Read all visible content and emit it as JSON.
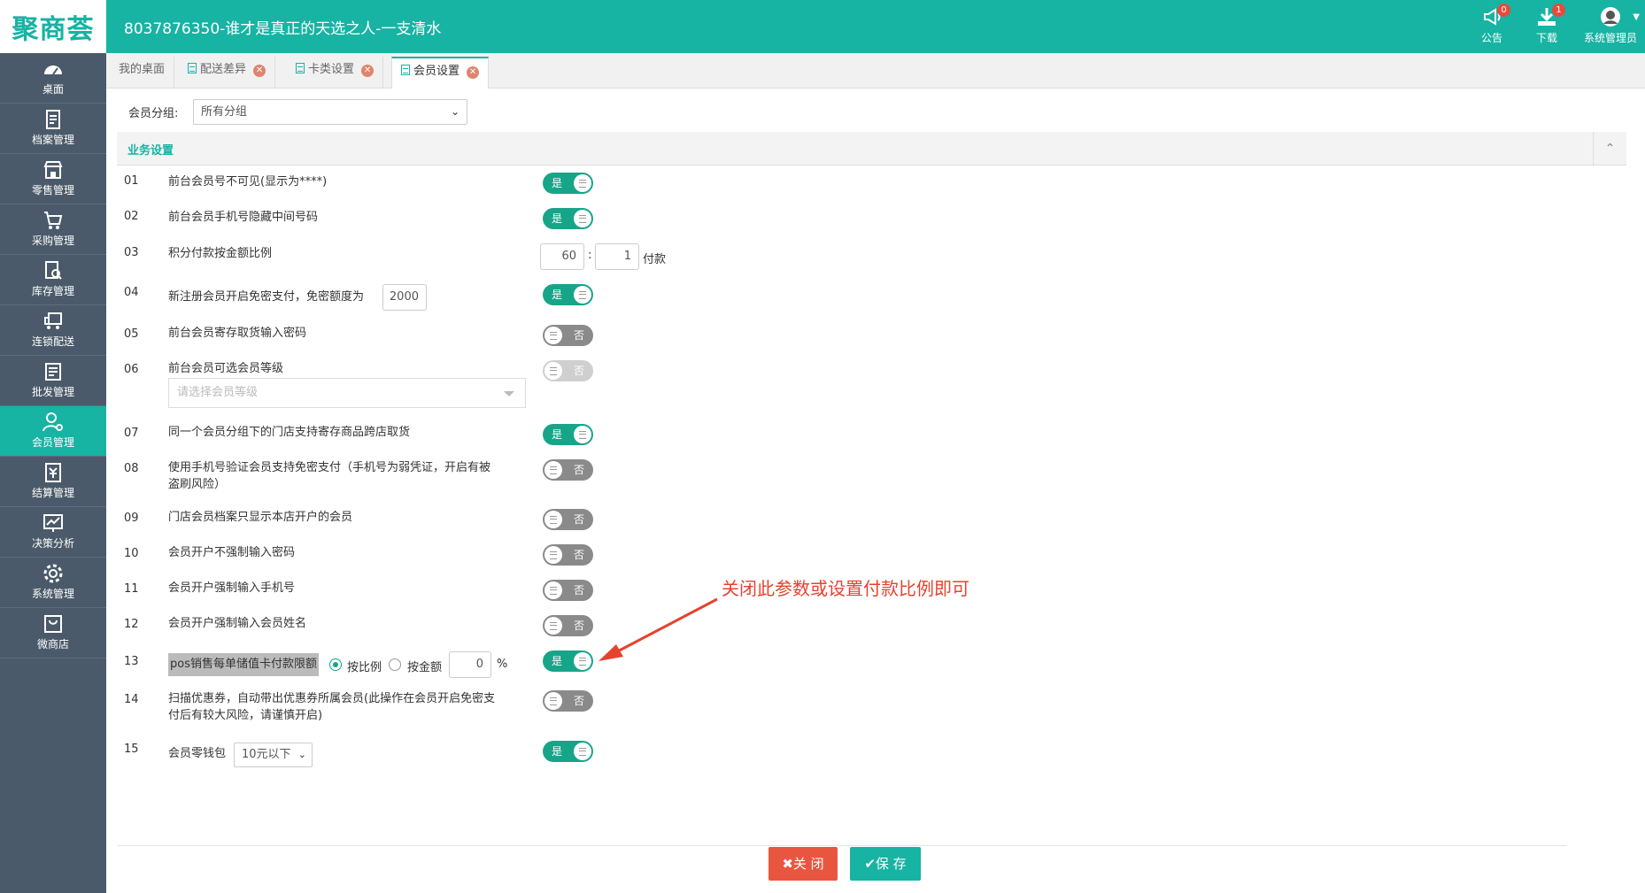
{
  "header": {
    "logo": "聚商荟",
    "title": "8037876350-谁才是真正的天选之人-一支清水",
    "announce": {
      "label": "公告",
      "count": "0"
    },
    "download": {
      "label": "下载",
      "count": "1"
    },
    "user": {
      "label": "系统管理员"
    }
  },
  "sidebar": {
    "items": [
      {
        "label": "桌面",
        "icon": "dashboard-icon"
      },
      {
        "label": "档案管理",
        "icon": "archive-icon"
      },
      {
        "label": "零售管理",
        "icon": "store-icon"
      },
      {
        "label": "采购管理",
        "icon": "cart-icon"
      },
      {
        "label": "库存管理",
        "icon": "inventory-icon"
      },
      {
        "label": "连锁配送",
        "icon": "truck-icon"
      },
      {
        "label": "批发管理",
        "icon": "wholesale-icon"
      },
      {
        "label": "会员管理",
        "icon": "member-icon"
      },
      {
        "label": "结算管理",
        "icon": "settlement-icon"
      },
      {
        "label": "决策分析",
        "icon": "chart-icon"
      },
      {
        "label": "系统管理",
        "icon": "gear-icon"
      },
      {
        "label": "微商店",
        "icon": "bag-icon"
      }
    ],
    "active_index": 7
  },
  "tabs": [
    {
      "label": "我的桌面"
    },
    {
      "label": "配送差异"
    },
    {
      "label": "卡类设置"
    },
    {
      "label": "会员设置"
    }
  ],
  "filter": {
    "label": "会员分组:",
    "value": "所有分组"
  },
  "section": {
    "title": "业务设置"
  },
  "rows": [
    {
      "num": "01",
      "label": "前台会员号不可见(显示为****)",
      "toggle": "是"
    },
    {
      "num": "02",
      "label": "前台会员手机号隐藏中间号码",
      "toggle": "是"
    },
    {
      "num": "03",
      "label": "积分付款按金额比例",
      "ratio_a": "60",
      "sep": ":",
      "ratio_b": "1",
      "unit": "付款"
    },
    {
      "num": "04",
      "label": "新注册会员开启免密支付，免密额度为",
      "amount": "2000",
      "toggle": "是"
    },
    {
      "num": "05",
      "label": "前台会员寄存取货输入密码",
      "toggle": "否"
    },
    {
      "num": "06",
      "label": "前台会员可选会员等级",
      "toggle": "否",
      "placeholder": "请选择会员等级"
    },
    {
      "num": "07",
      "label": "同一个会员分组下的门店支持寄存商品跨店取货",
      "toggle": "是"
    },
    {
      "num": "08",
      "label_line1": "使用手机号验证会员支持免密支付（手机号为弱凭证，开启有被",
      "label_line2": "盗刷风险）",
      "toggle": "否"
    },
    {
      "num": "09",
      "label": "门店会员档案只显示本店开户的会员",
      "toggle": "否"
    },
    {
      "num": "10",
      "label": "会员开户不强制输入密码",
      "toggle": "否"
    },
    {
      "num": "11",
      "label": "会员开户强制输入手机号",
      "toggle": "否"
    },
    {
      "num": "12",
      "label": "会员开户强制输入会员姓名",
      "toggle": "否"
    },
    {
      "num": "13",
      "label": "pos销售每单储值卡付款限额",
      "radio_a": "按比例",
      "radio_b": "按金额",
      "value": "0",
      "unit": "%",
      "toggle": "是"
    },
    {
      "num": "14",
      "label_line1": "扫描优惠券，自动带出优惠券所属会员(此操作在会员开启免密支",
      "label_line2": "付后有较大风险，请谨慎开启)",
      "toggle": "否"
    },
    {
      "num": "15",
      "label": "会员零钱包",
      "select": "10元以下",
      "toggle": "是"
    }
  ],
  "annotation": "关闭此参数或设置付款比例即可",
  "buttons": {
    "close": "关 闭",
    "save": "保 存"
  },
  "colors": {
    "primary": "#17b3a3",
    "sidebar": "#4b5a6a",
    "toggle_on": "#17a589",
    "toggle_off": "#8a8a8a",
    "danger": "#e8563f",
    "annotation": "#e5432e"
  }
}
